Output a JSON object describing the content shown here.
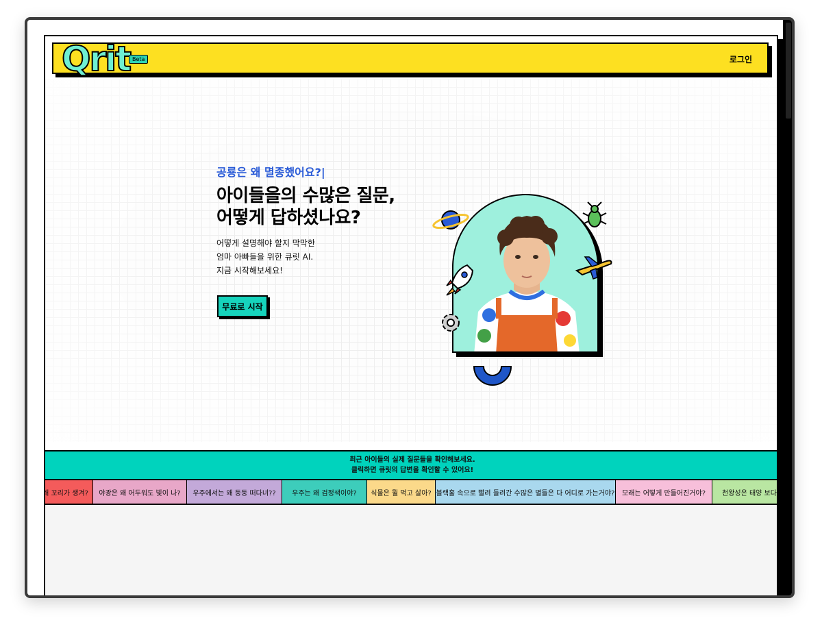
{
  "header": {
    "logo": "Qrit",
    "badge": "Beta",
    "login": "로그인",
    "bg_color": "#FDE021"
  },
  "hero": {
    "eyebrow": "공룡은 왜 멸종했어요?|",
    "headline": "아이들을의 수많은 질문,\n어떻게 답하셨나요?",
    "desc": [
      "어떻게 설명해야 할지 막막한",
      "엄마 아빠들을 위한 큐릿 AI.",
      "지금 시작해보세요!"
    ],
    "cta": "무료로 시작",
    "icons": [
      "planet-icon",
      "beetle-icon",
      "rocket-icon",
      "airplane-icon",
      "gear-icon",
      "horseshoe-shape"
    ]
  },
  "ticker": {
    "line1": "최근 아이들의 실제 질문들을 확인해보세요.",
    "line2": "클릭하면 큐릿의 답변을 확인할 수 있어요!",
    "bg_color": "#00D3BD",
    "chips": [
      {
        "text": "왜 꼬리가 생겨?",
        "color": "#F45B5B"
      },
      {
        "text": "야광은 왜 어두워도 빛이 나?",
        "color": "#E8A7C8"
      },
      {
        "text": "우주에서는 왜 둥둥 떠다녀??",
        "color": "#C3A9D9"
      },
      {
        "text": "우주는 왜 검정색이야?",
        "color": "#3DCDBB"
      },
      {
        "text": "식물은 뭘 먹고 살아?",
        "color": "#FBD98A"
      },
      {
        "text": "블랙홀 속으로 빨려 들려간 수많은 별들은 다 어디로 가는거야?",
        "color": "#A9D8EE"
      },
      {
        "text": "모래는 어떻게 만들어진거야?",
        "color": "#F7BFDA"
      },
      {
        "text": "천왕성은 태양 보다 뜨거워?",
        "color": "#B9E6A2"
      }
    ]
  }
}
